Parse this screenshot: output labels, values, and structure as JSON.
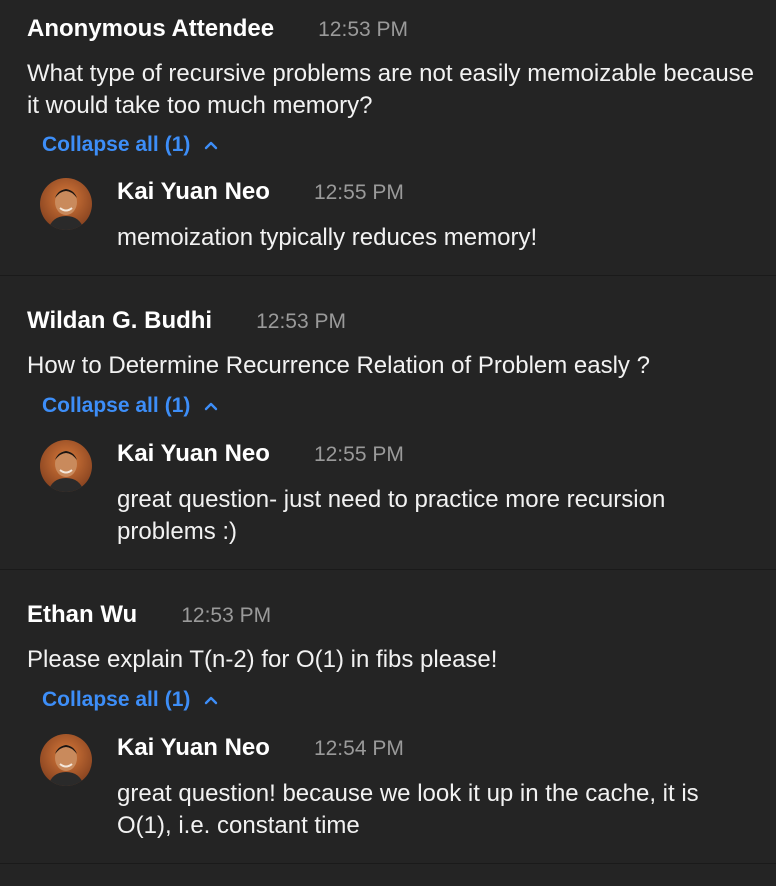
{
  "colors": {
    "background": "#242424",
    "divider": "#1a1a1a",
    "link_blue": "#3d8ef8",
    "timestamp_gray": "#9a9a9a"
  },
  "questions": [
    {
      "author": "Anonymous Attendee",
      "time": "12:53 PM",
      "text": "What type of recursive problems are not easily memoizable because it would take too much memory?",
      "collapse_label": "Collapse all",
      "collapse_count": "(1)",
      "answer": {
        "author": "Kai Yuan Neo",
        "time": "12:55 PM",
        "text": "memoization typically reduces memory!",
        "avatar_icon": "user-avatar"
      }
    },
    {
      "author": "Wildan G. Budhi",
      "time": "12:53 PM",
      "text": "How to Determine Recurrence Relation of Problem easly ?",
      "collapse_label": "Collapse all",
      "collapse_count": "(1)",
      "answer": {
        "author": "Kai Yuan Neo",
        "time": "12:55 PM",
        "text": "great question- just need to practice more recursion problems :)",
        "avatar_icon": "user-avatar"
      }
    },
    {
      "author": "Ethan Wu",
      "time": "12:53 PM",
      "text": "Please explain T(n-2) for O(1) in fibs please!",
      "collapse_label": "Collapse all",
      "collapse_count": "(1)",
      "answer": {
        "author": "Kai Yuan Neo",
        "time": "12:54 PM",
        "text": "great question! because we look it up in the cache, it is O(1), i.e. constant time",
        "avatar_icon": "user-avatar"
      }
    }
  ]
}
